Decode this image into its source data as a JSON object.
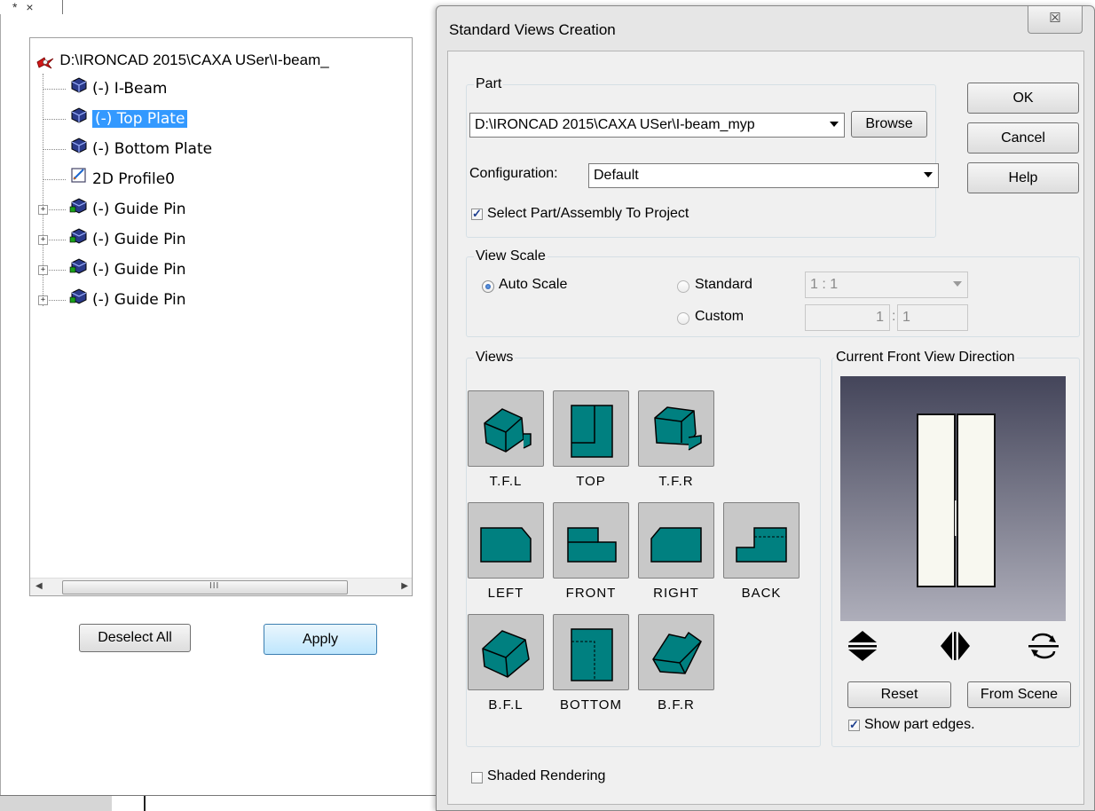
{
  "left_panel": {
    "tab_marks": "*  ×",
    "tree": {
      "root": "D:\\IRONCAD 2015\\CAXA USer\\I-beam_",
      "items": [
        {
          "label": "(-) I-Beam",
          "icon": "part-icon",
          "selected": false,
          "expandable": false
        },
        {
          "label": "(-) Top Plate",
          "icon": "part-icon",
          "selected": true,
          "expandable": false
        },
        {
          "label": "(-) Bottom Plate",
          "icon": "part-icon",
          "selected": false,
          "expandable": false
        },
        {
          "label": "2D Profile0",
          "icon": "profile-icon",
          "selected": false,
          "expandable": false
        },
        {
          "label": "(-) Guide Pin",
          "icon": "assembly-icon",
          "selected": false,
          "expandable": true
        },
        {
          "label": "(-) Guide Pin",
          "icon": "assembly-icon",
          "selected": false,
          "expandable": true
        },
        {
          "label": "(-) Guide Pin",
          "icon": "assembly-icon",
          "selected": false,
          "expandable": true
        },
        {
          "label": "(-) Guide Pin",
          "icon": "assembly-icon",
          "selected": false,
          "expandable": true
        }
      ]
    },
    "scroll_grip": "III",
    "deselect_all_label": "Deselect All",
    "apply_label": "Apply"
  },
  "dialog": {
    "title": "Standard Views Creation",
    "close_glyph": "☒",
    "part": {
      "legend": "Part",
      "path_value": "D:\\IRONCAD 2015\\CAXA USer\\I-beam_myp",
      "browse_label": "Browse",
      "configuration_label": "Configuration:",
      "configuration_value": "Default",
      "select_part_label": "Select Part/Assembly To Project",
      "select_part_checked": true
    },
    "buttons": {
      "ok": "OK",
      "cancel": "Cancel",
      "help": "Help"
    },
    "view_scale": {
      "legend": "View Scale",
      "auto_label": "Auto Scale",
      "standard_label": "Standard",
      "custom_label": "Custom",
      "selected": "auto",
      "standard_value": "1 : 1",
      "custom_left": "1",
      "custom_sep": ":",
      "custom_right": "1"
    },
    "views": {
      "legend": "Views",
      "items": [
        "T.F.L",
        "TOP",
        "T.F.R",
        "LEFT",
        "FRONT",
        "RIGHT",
        "BACK",
        "B.F.L",
        "BOTTOM",
        "B.F.R"
      ]
    },
    "front_direction": {
      "legend": "Current Front View Direction",
      "reset_label": "Reset",
      "from_scene_label": "From Scene",
      "show_edges_label": "Show part edges.",
      "show_edges_checked": true
    },
    "shaded_rendering_label": "Shaded Rendering",
    "shaded_rendering_checked": false
  },
  "colors": {
    "accent_teal": "#008080",
    "selection_blue": "#3399ff"
  }
}
